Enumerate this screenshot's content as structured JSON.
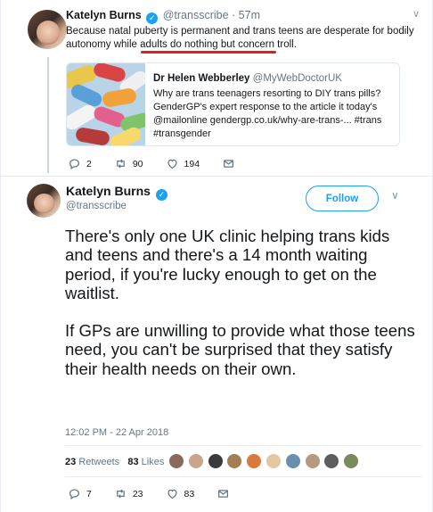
{
  "tweet1": {
    "name": "Katelyn Burns",
    "handle": "@transscribe",
    "time": "57m",
    "text": "Because natal puberty is permanent and trans teens are desperate for bodily autonomy while adults do nothing but concern troll.",
    "quote": {
      "name": "Dr Helen Webberley",
      "handle": "@MyWebDoctorUK",
      "text": "Why are trans teenagers resorting to DIY trans pills? GenderGP's expert response to the article it today's @mailonline gendergp.co.uk/why-are-trans-... #trans #transgender"
    },
    "replies": "2",
    "retweets": "90",
    "likes": "194"
  },
  "tweet2": {
    "name": "Katelyn Burns",
    "handle": "@transscribe",
    "follow_label": "Follow",
    "paragraph1": "There's only one UK clinic helping trans kids and teens and there's a 14 month waiting period, if you're lucky enough to get on the waitlist.",
    "paragraph2": "If GPs are unwilling to provide what those teens need, you can't be surprised that they satisfy their health needs on their own.",
    "timestamp": "12:02 PM - 22 Apr 2018",
    "retweet_count": "23",
    "retweet_label": "Retweets",
    "like_count": "83",
    "like_label": "Likes",
    "replies": "7",
    "retweets": "23",
    "likes": "83"
  },
  "colors": {
    "accent": "#1da1f2",
    "muted": "#657786",
    "highlight_underline": "#e0201e"
  }
}
